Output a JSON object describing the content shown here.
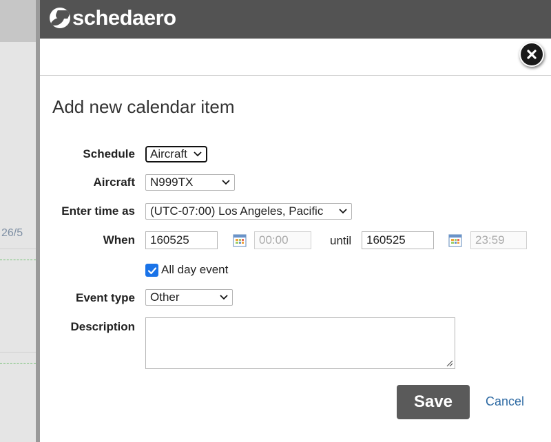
{
  "background": {
    "date_fragment": "26/5"
  },
  "header": {
    "brand_name": "schedaero",
    "brand_color": "#535353"
  },
  "dialog": {
    "title": "Add new calendar item",
    "close_icon": "close-icon"
  },
  "form": {
    "schedule": {
      "label": "Schedule",
      "selected": "Aircraft"
    },
    "aircraft": {
      "label": "Aircraft",
      "selected": "N999TX"
    },
    "time_zone": {
      "label": "Enter time as",
      "selected": "(UTC-07:00) Los Angeles, Pacific"
    },
    "when": {
      "label": "When",
      "start_date": "160525",
      "start_time": "00:00",
      "until_label": "until",
      "end_date": "160525",
      "end_time": "23:59",
      "calendar_icon": "calendar-icon"
    },
    "all_day": {
      "label": "All day event",
      "checked": true,
      "check_color": "#1a73e8"
    },
    "event_type": {
      "label": "Event type",
      "selected": "Other"
    },
    "description": {
      "label": "Description",
      "value": ""
    }
  },
  "actions": {
    "save_label": "Save",
    "cancel_label": "Cancel",
    "cancel_color": "#2e6aa3"
  }
}
